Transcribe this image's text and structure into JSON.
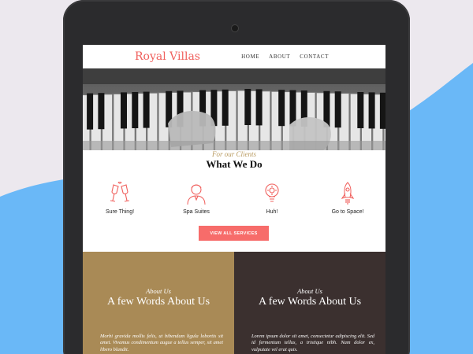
{
  "site": {
    "logo": "Royal Villas"
  },
  "nav": {
    "items": [
      "HOME",
      "ABOUT",
      "CONTACT"
    ]
  },
  "services": {
    "eyebrow": "For our Clients",
    "title": "What We Do",
    "items": [
      {
        "label": "Sure Thing!",
        "icon": "champagne-glasses-icon"
      },
      {
        "label": "Spa Suites",
        "icon": "person-icon"
      },
      {
        "label": "Huh!",
        "icon": "lightbulb-icon"
      },
      {
        "label": "Go to Space!",
        "icon": "rocket-icon"
      }
    ],
    "button": "VIEW ALL SERVICES"
  },
  "about": [
    {
      "eyebrow": "About Us",
      "title": "A few Words About Us",
      "body": "Morbi gravida mollis felis, ut bibendum ligula lobortis sit amet. Vivamus condimentum augue a tellus semper, sit amet libero blandit."
    },
    {
      "eyebrow": "About Us",
      "title": "A few Words About Us",
      "body": "Lorem ipsum dolor sit amet, consectetur adipiscing elit. Sed id fermentum tellus, a tristique nibh. Nam dolor ex, vulputate vel erat quis."
    }
  ],
  "colors": {
    "accent": "#f0605d",
    "button": "#f76c6a",
    "gold": "#a98a56",
    "dark": "#3b302f",
    "background_wave": "#6ab8f7"
  }
}
